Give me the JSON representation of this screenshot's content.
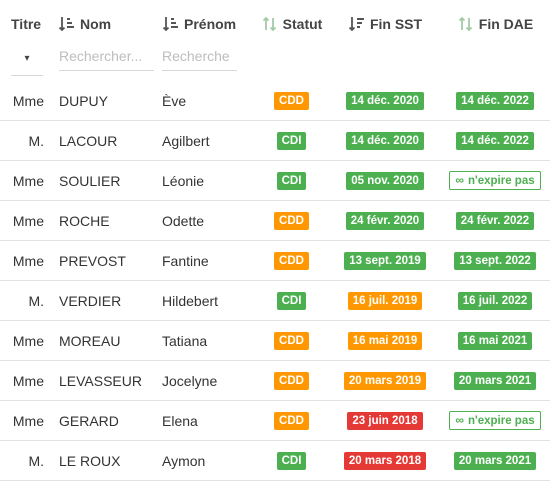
{
  "columns": {
    "titre": "Titre",
    "nom": "Nom",
    "prenom": "Prénom",
    "statut": "Statut",
    "fin_sst": "Fin SST",
    "fin_dae": "Fin DAE"
  },
  "filters": {
    "titre_caret": "▾",
    "nom_placeholder": "Rechercher...",
    "prenom_placeholder": "Recherche"
  },
  "colors": {
    "green": "#4caf50",
    "orange": "#ff9800",
    "red": "#e53935"
  },
  "rows": [
    {
      "titre": "Mme",
      "nom": "DUPUY",
      "prenom": "Ève",
      "statut": "CDD",
      "statut_color": "orange",
      "sst": "14 déc. 2020",
      "sst_color": "green",
      "dae": "14 déc. 2022",
      "dae_color": "green"
    },
    {
      "titre": "M.",
      "nom": "LACOUR",
      "prenom": "Agilbert",
      "statut": "CDI",
      "statut_color": "green",
      "sst": "14 déc. 2020",
      "sst_color": "green",
      "dae": "14 déc. 2022",
      "dae_color": "green"
    },
    {
      "titre": "Mme",
      "nom": "SOULIER",
      "prenom": "Léonie",
      "statut": "CDI",
      "statut_color": "green",
      "sst": "05 nov. 2020",
      "sst_color": "green",
      "dae": "n'expire pas",
      "dae_color": "outline"
    },
    {
      "titre": "Mme",
      "nom": "ROCHE",
      "prenom": "Odette",
      "statut": "CDD",
      "statut_color": "orange",
      "sst": "24 févr. 2020",
      "sst_color": "green",
      "dae": "24 févr. 2022",
      "dae_color": "green"
    },
    {
      "titre": "Mme",
      "nom": "PREVOST",
      "prenom": "Fantine",
      "statut": "CDD",
      "statut_color": "orange",
      "sst": "13 sept. 2019",
      "sst_color": "green",
      "dae": "13 sept. 2022",
      "dae_color": "green"
    },
    {
      "titre": "M.",
      "nom": "VERDIER",
      "prenom": "Hildebert",
      "statut": "CDI",
      "statut_color": "green",
      "sst": "16 juil. 2019",
      "sst_color": "orange",
      "dae": "16 juil. 2022",
      "dae_color": "green"
    },
    {
      "titre": "Mme",
      "nom": "MOREAU",
      "prenom": "Tatiana",
      "statut": "CDD",
      "statut_color": "orange",
      "sst": "16 mai 2019",
      "sst_color": "orange",
      "dae": "16 mai 2021",
      "dae_color": "green"
    },
    {
      "titre": "Mme",
      "nom": "LEVASSEUR",
      "prenom": "Jocelyne",
      "statut": "CDD",
      "statut_color": "orange",
      "sst": "20 mars 2019",
      "sst_color": "orange",
      "dae": "20 mars 2021",
      "dae_color": "green"
    },
    {
      "titre": "Mme",
      "nom": "GERARD",
      "prenom": "Elena",
      "statut": "CDD",
      "statut_color": "orange",
      "sst": "23 juin 2018",
      "sst_color": "red",
      "dae": "n'expire pas",
      "dae_color": "outline"
    },
    {
      "titre": "M.",
      "nom": "LE ROUX",
      "prenom": "Aymon",
      "statut": "CDI",
      "statut_color": "green",
      "sst": "20 mars 2018",
      "sst_color": "red",
      "dae": "20 mars 2021",
      "dae_color": "green"
    }
  ]
}
